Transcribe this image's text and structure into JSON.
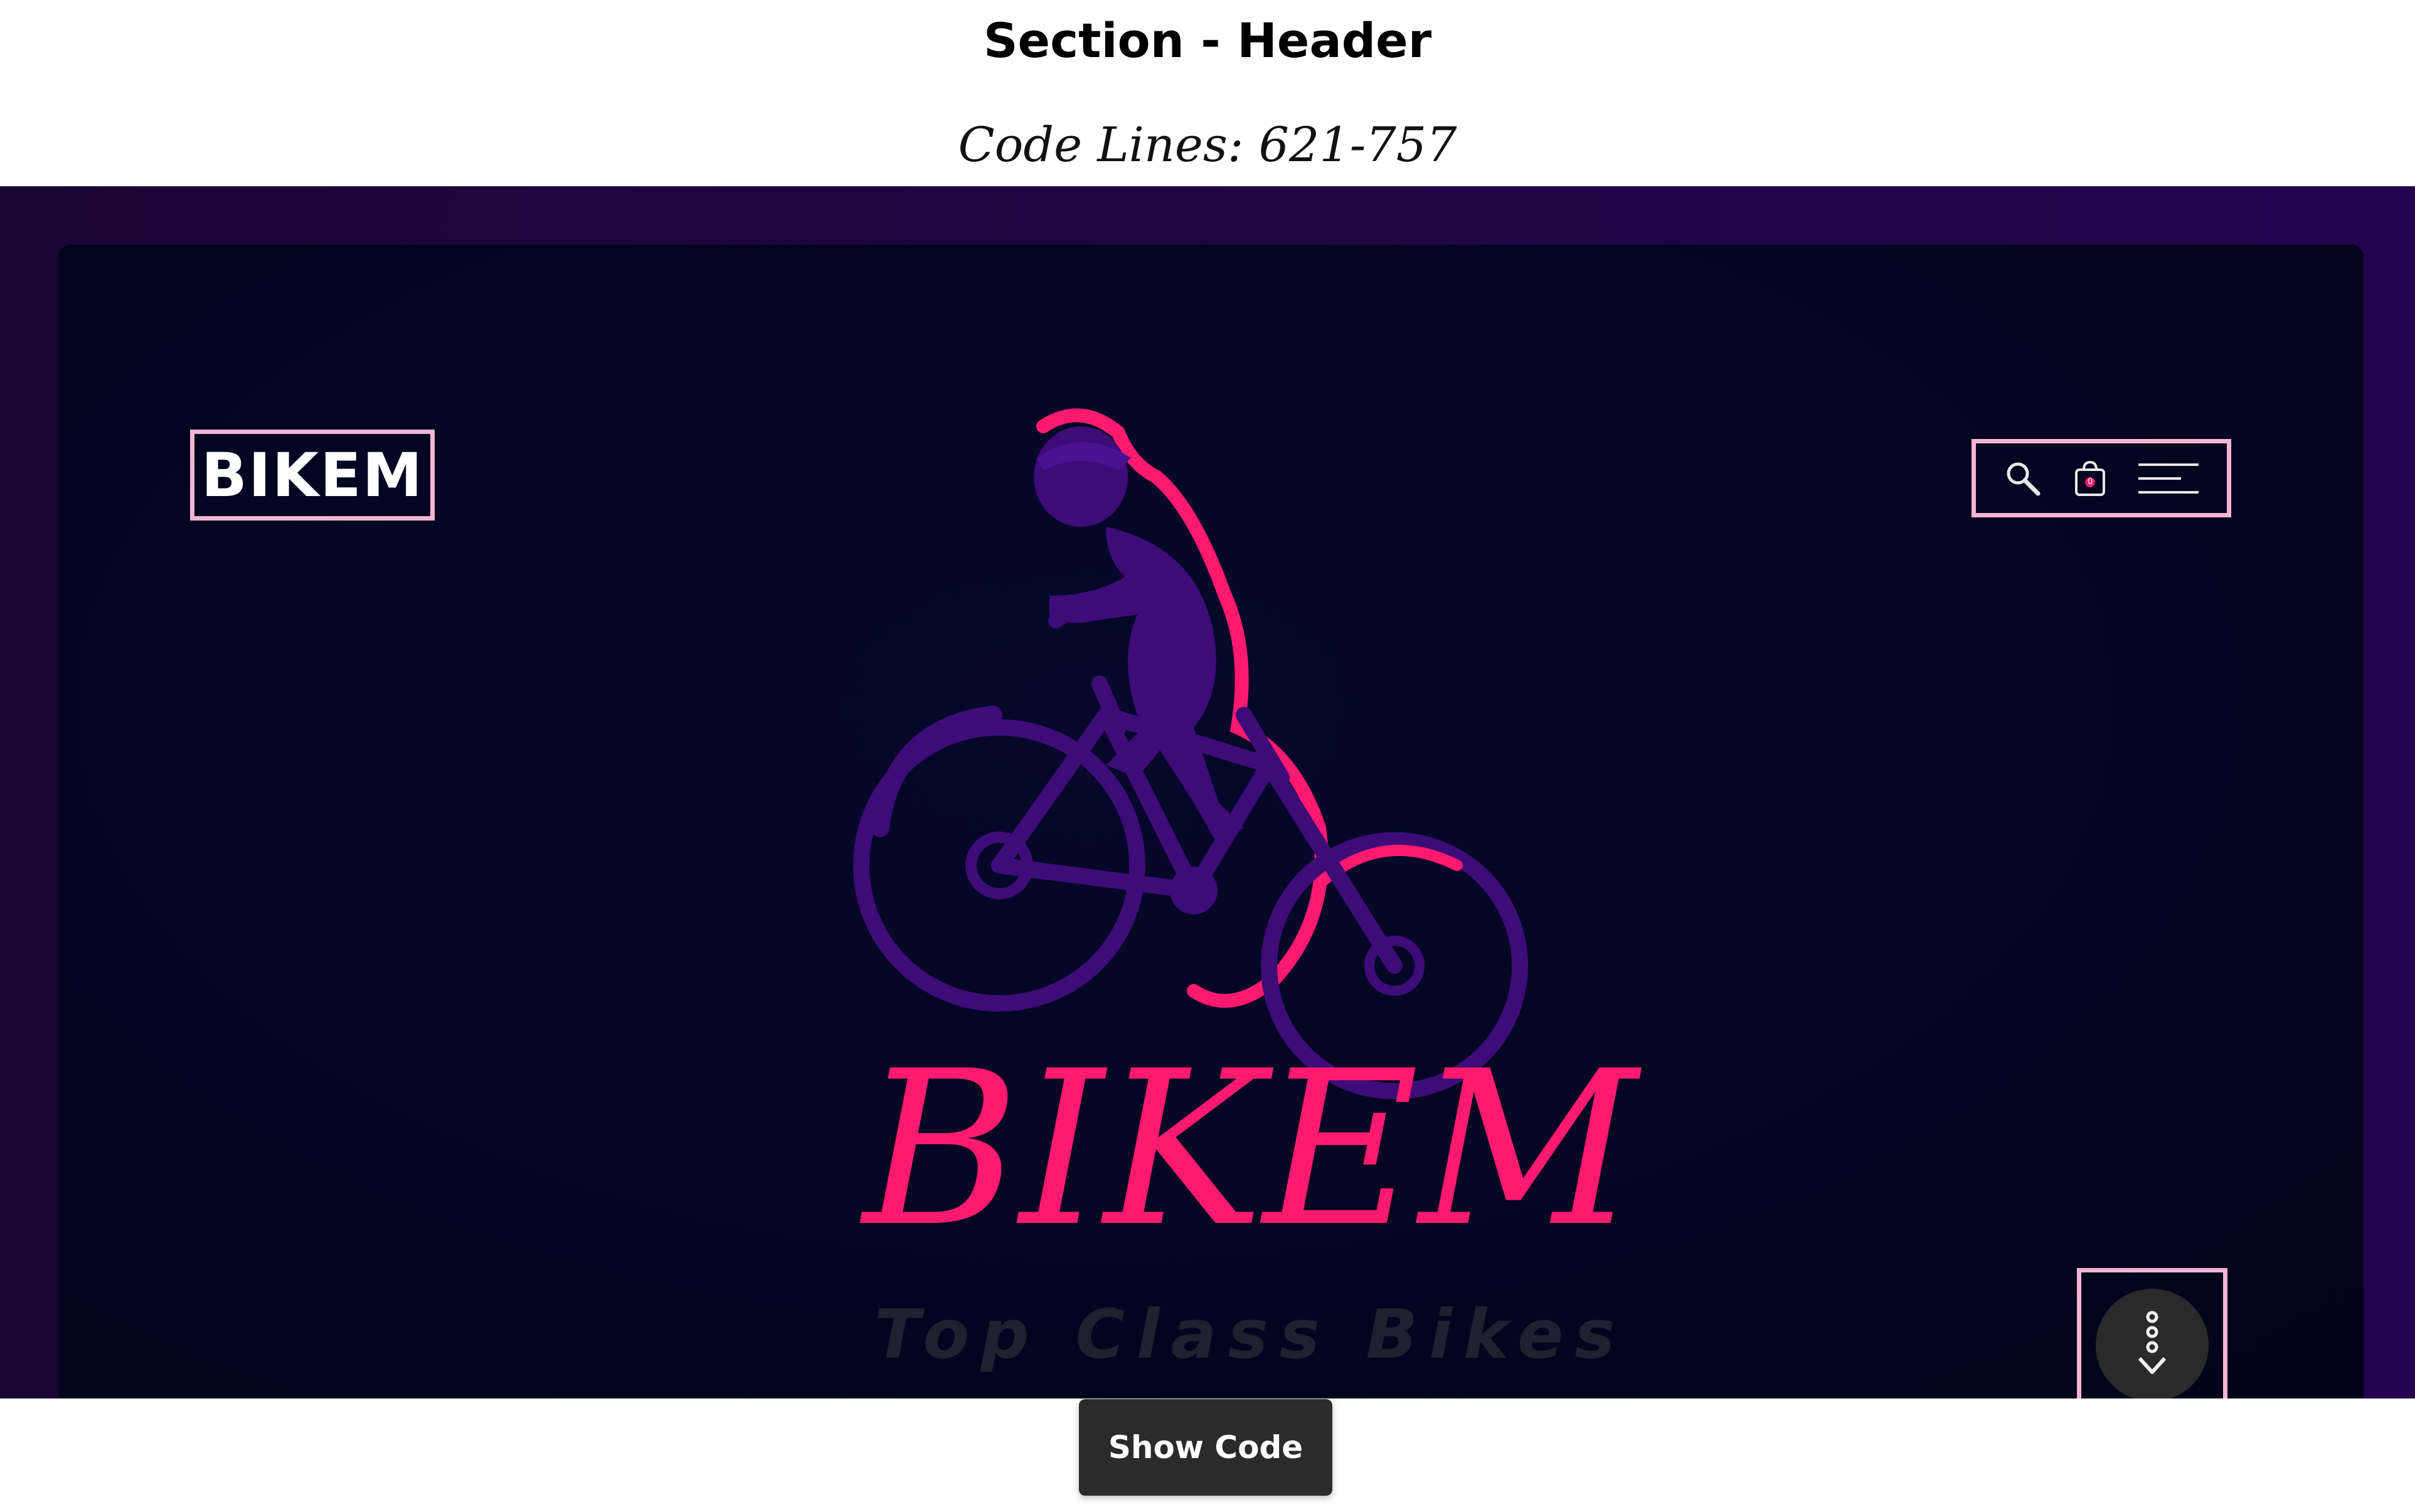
{
  "section": {
    "title": "Section - Header",
    "code_lines": "Code Lines: 621-757"
  },
  "header": {
    "logo_text": "BIKEM",
    "nav_icons": [
      "search-icon",
      "shopping-bag-icon",
      "menu-icon"
    ],
    "cart_count": "0"
  },
  "hero": {
    "brand": "BIKEM",
    "tagline": "Top Class Bikes"
  },
  "scroll_button": {
    "icon": "scroll-down-icon"
  },
  "footer": {
    "show_code_label": "Show Code"
  },
  "colors": {
    "frame_background": "#24044f",
    "hero_background": "#030520",
    "accent_pink": "#ff1a70",
    "rider_purple": "#3d0c79",
    "outline_pink": "#f3b6d2"
  }
}
